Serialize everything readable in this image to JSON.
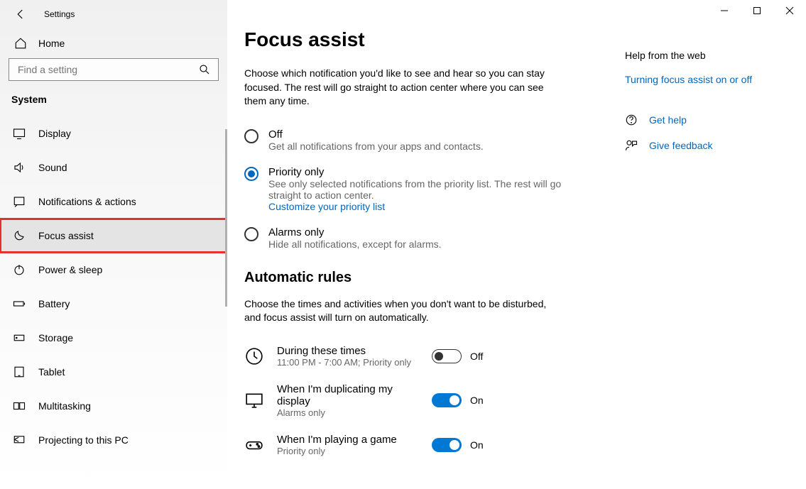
{
  "window": {
    "title": "Settings"
  },
  "sidebar": {
    "home": "Home",
    "search_placeholder": "Find a setting",
    "section": "System",
    "items": [
      {
        "label": "Display"
      },
      {
        "label": "Sound"
      },
      {
        "label": "Notifications & actions"
      },
      {
        "label": "Focus assist"
      },
      {
        "label": "Power & sleep"
      },
      {
        "label": "Battery"
      },
      {
        "label": "Storage"
      },
      {
        "label": "Tablet"
      },
      {
        "label": "Multitasking"
      },
      {
        "label": "Projecting to this PC"
      }
    ]
  },
  "main": {
    "title": "Focus assist",
    "description": "Choose which notification you'd like to see and hear so you can stay focused. The rest will go straight to action center where you can see them any time.",
    "options": [
      {
        "label": "Off",
        "sub": "Get all notifications from your apps and contacts."
      },
      {
        "label": "Priority only",
        "sub": "See only selected notifications from the priority list. The rest will go straight to action center.",
        "link": "Customize your priority list"
      },
      {
        "label": "Alarms only",
        "sub": "Hide all notifications, except for alarms."
      }
    ],
    "rules_heading": "Automatic rules",
    "rules_desc": "Choose the times and activities when you don't want to be disturbed, and focus assist will turn on automatically.",
    "rules": [
      {
        "label": "During these times",
        "sub": "11:00 PM - 7:00 AM; Priority only",
        "state": "Off"
      },
      {
        "label": "When I'm duplicating my display",
        "sub": "Alarms only",
        "state": "On"
      },
      {
        "label": "When I'm playing a game",
        "sub": "Priority only",
        "state": "On"
      }
    ]
  },
  "help": {
    "heading": "Help from the web",
    "link": "Turning focus assist on or off",
    "get_help": "Get help",
    "feedback": "Give feedback"
  }
}
